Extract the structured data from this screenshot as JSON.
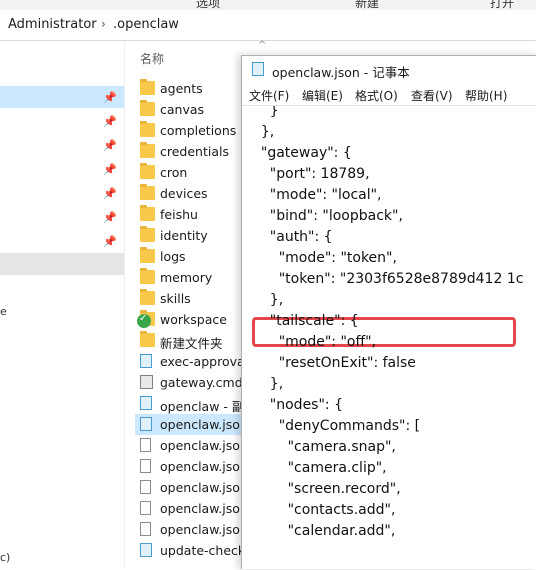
{
  "address": {
    "crumbs": [
      "Administrator",
      ".openclaw"
    ],
    "separator": "›"
  },
  "ribbon": {
    "labels": [
      "选项",
      "新建",
      "打开"
    ]
  },
  "explorer": {
    "column_header": "名称",
    "files": [
      {
        "name": "agents",
        "type": "folder"
      },
      {
        "name": "canvas",
        "type": "folder"
      },
      {
        "name": "completions",
        "type": "folder"
      },
      {
        "name": "credentials",
        "type": "folder"
      },
      {
        "name": "cron",
        "type": "folder"
      },
      {
        "name": "devices",
        "type": "folder"
      },
      {
        "name": "feishu",
        "type": "folder"
      },
      {
        "name": "identity",
        "type": "folder"
      },
      {
        "name": "logs",
        "type": "folder"
      },
      {
        "name": "memory",
        "type": "folder"
      },
      {
        "name": "skills",
        "type": "folder"
      },
      {
        "name": "workspace",
        "type": "folder-synced"
      },
      {
        "name": "新建文件夹",
        "type": "folder"
      },
      {
        "name": "exec-approva",
        "type": "notepad"
      },
      {
        "name": "gateway.cmd",
        "type": "cmd"
      },
      {
        "name": "openclaw - 副",
        "type": "notepad"
      },
      {
        "name": "openclaw.json",
        "type": "notepad",
        "selected": true
      },
      {
        "name": "openclaw.json",
        "type": "doc"
      },
      {
        "name": "openclaw.json",
        "type": "doc"
      },
      {
        "name": "openclaw.json",
        "type": "doc"
      },
      {
        "name": "openclaw.json",
        "type": "doc"
      },
      {
        "name": "openclaw.json",
        "type": "doc"
      },
      {
        "name": "update-check.",
        "type": "notepad"
      }
    ]
  },
  "nav_edge": {
    "e": "e",
    "c": "c)"
  },
  "notepad": {
    "title": "openclaw.json - 记事本",
    "menu": [
      "文件(F)",
      "编辑(E)",
      "格式(O)",
      "查看(V)",
      "帮助(H)"
    ],
    "lines": [
      "    }",
      "  },",
      "  \"gateway\": {",
      "    \"port\": 18789,",
      "    \"mode\": \"local\",",
      "    \"bind\": \"loopback\",",
      "    \"auth\": {",
      "      \"mode\": \"token\",",
      "      \"token\": \"2303f6528e8789d412 1c",
      "    },",
      "    \"tailscale\": {",
      "      \"mode\": \"off\",",
      "      \"resetOnExit\": false",
      "    },",
      "    \"nodes\": {",
      "      \"denyCommands\": [",
      "        \"camera.snap\",",
      "        \"camera.clip\",",
      "        \"screen.record\",",
      "        \"contacts.add\",",
      "        \"calendar.add\","
    ],
    "highlight_color": "#e5474b"
  }
}
